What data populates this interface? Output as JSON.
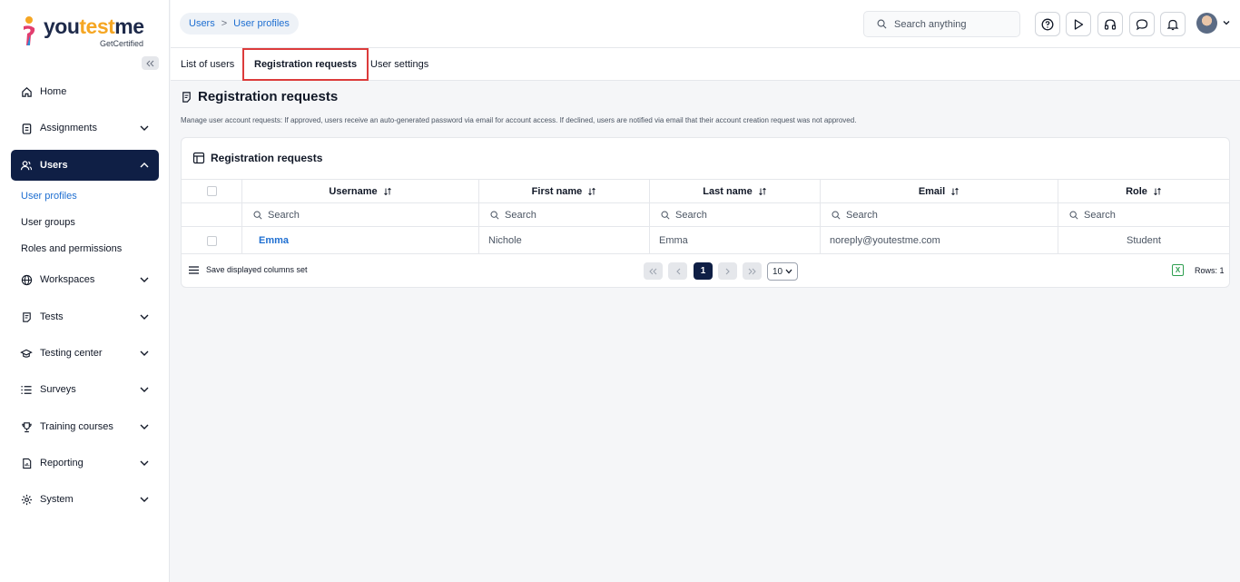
{
  "brand": {
    "name_part1": "you",
    "name_accent": "test",
    "name_part2": "me",
    "tagline": "GetCertified"
  },
  "sidebar": {
    "items": [
      {
        "label": "Home",
        "icon": "home-icon",
        "expandable": false
      },
      {
        "label": "Assignments",
        "icon": "clipboard-icon",
        "expandable": true
      },
      {
        "label": "Users",
        "icon": "users-icon",
        "expandable": true,
        "active": true
      },
      {
        "label": "Workspaces",
        "icon": "globe-icon",
        "expandable": true
      },
      {
        "label": "Tests",
        "icon": "test-icon",
        "expandable": true
      },
      {
        "label": "Testing center",
        "icon": "graduation-cap-icon",
        "expandable": true
      },
      {
        "label": "Surveys",
        "icon": "list-icon",
        "expandable": true
      },
      {
        "label": "Training courses",
        "icon": "trophy-icon",
        "expandable": true
      },
      {
        "label": "Reporting",
        "icon": "report-icon",
        "expandable": true
      },
      {
        "label": "System",
        "icon": "gear-icon",
        "expandable": true
      }
    ],
    "users_sub": [
      {
        "label": "User profiles",
        "active": true
      },
      {
        "label": "User groups"
      },
      {
        "label": "Roles and permissions"
      }
    ]
  },
  "header": {
    "breadcrumb": [
      "Users",
      "User profiles"
    ],
    "breadcrumb_sep": ">",
    "search_placeholder": "Search anything",
    "icons": [
      "help-icon",
      "play-icon",
      "headset-icon",
      "chat-icon",
      "bell-icon"
    ]
  },
  "tabs": [
    {
      "label": "List of users"
    },
    {
      "label": "Registration requests",
      "active": true
    },
    {
      "label": "User settings"
    }
  ],
  "page": {
    "title": "Registration requests",
    "description": "Manage user account requests: If approved, users receive an auto-generated password via email for account access. If declined, users are notified via email that their account creation request was not approved."
  },
  "table": {
    "title": "Registration requests",
    "columns": [
      "Username",
      "First name",
      "Last name",
      "Email",
      "Role"
    ],
    "search_placeholder": "Search",
    "rows": [
      {
        "username": "Emma",
        "first_name": "Nichole",
        "last_name": "Emma",
        "email": "noreply@youtestme.com",
        "role": "Student"
      }
    ],
    "footer": {
      "save_columns": "Save displayed columns set",
      "current_page": "1",
      "page_size": "10",
      "rows_label": "Rows: 1"
    }
  },
  "colors": {
    "accent": "#1f6fd1",
    "nav_active": "#0f1f45",
    "tab_highlight": "#dc3b3b",
    "brand_orange": "#f5a623"
  }
}
